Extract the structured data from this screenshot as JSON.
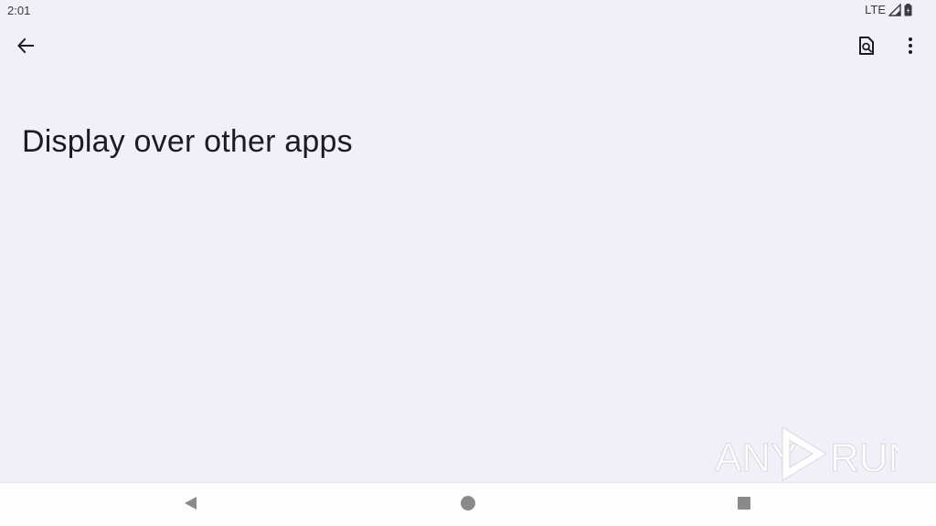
{
  "status_bar": {
    "time": "2:01",
    "network": "LTE",
    "icons": [
      "signal-icon",
      "battery-icon"
    ]
  },
  "app_bar": {
    "icons": [
      "arrow-back-icon",
      "search-in-page-icon",
      "more-vert-icon"
    ]
  },
  "page": {
    "title": "Display over other apps"
  },
  "watermark": {
    "text_left": "ANY",
    "text_right": "RUN"
  },
  "nav_bar": {
    "icons": [
      "nav-back-icon",
      "nav-home-icon",
      "nav-recents-icon"
    ]
  },
  "colors": {
    "background": "#f1f0f8",
    "text": "#1b1b21",
    "nav_bar": "#fdfdfd",
    "nav_icon": "#8a8a8a"
  }
}
